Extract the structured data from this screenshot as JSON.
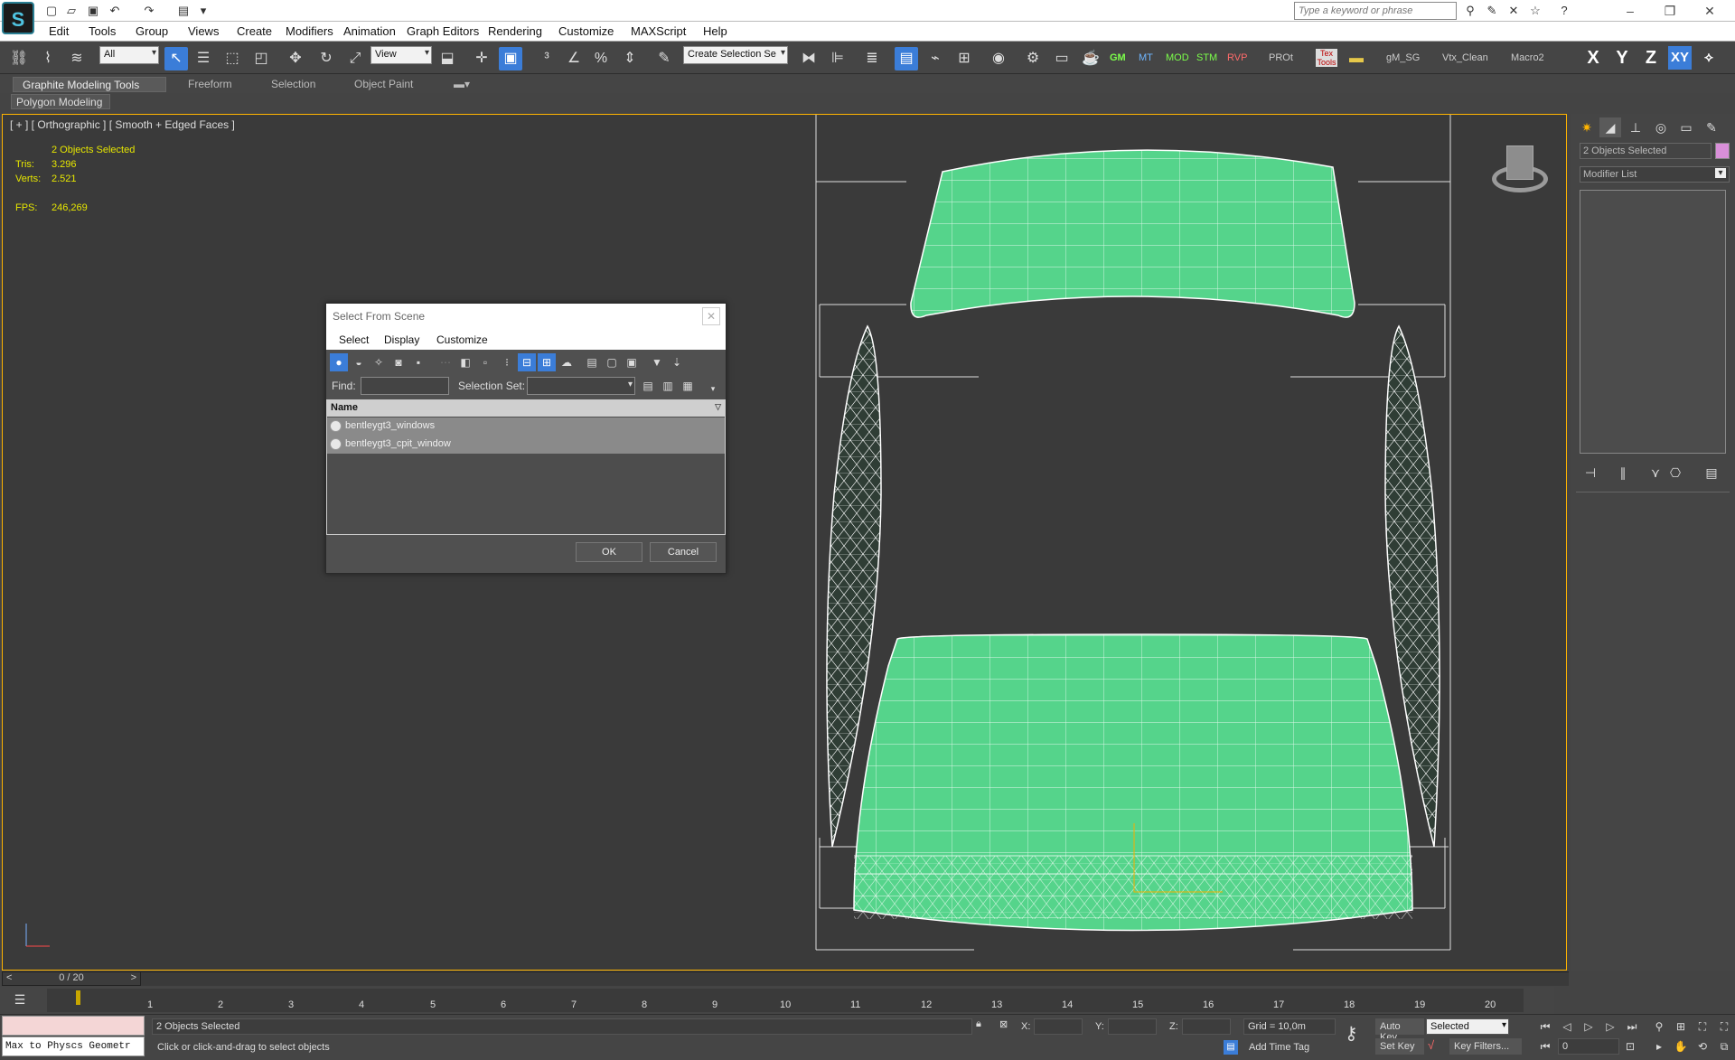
{
  "quick_access": {
    "search_placeholder": "Type a keyword or phrase"
  },
  "menu": [
    "Edit",
    "Tools",
    "Group",
    "Views",
    "Create",
    "Modifiers",
    "Animation",
    "Graph Editors",
    "Rendering",
    "Customize",
    "MAXScript",
    "Help"
  ],
  "toolbar": {
    "selection_filter": "All",
    "ref_coord": "View",
    "named_selection": "Create Selection Se",
    "scripts": [
      "GM",
      "MT",
      "MOD",
      "STM",
      "RVP",
      "PROt",
      "Tex Tools",
      "gM_SG",
      "Vtx_Clean",
      "Macro2"
    ],
    "axes": [
      "X",
      "Y",
      "Z",
      "XY"
    ]
  },
  "ribbon": {
    "tabs": [
      "Graphite Modeling Tools",
      "Freeform",
      "Selection",
      "Object Paint"
    ],
    "sub_panel": "Polygon Modeling"
  },
  "viewport": {
    "label": "[ + ] [ Orthographic ] [ Smooth + Edged Faces ]",
    "selected_caption": "2 Objects Selected",
    "tris_label": "Tris:",
    "tris_value": "3.296",
    "verts_label": "Verts:",
    "verts_value": "2.521",
    "fps_label": "FPS:",
    "fps_value": "246,269",
    "mesh_color": "#55d48b"
  },
  "dialog": {
    "title": "Select From Scene",
    "menu": [
      "Select",
      "Display",
      "Customize"
    ],
    "find_label": "Find:",
    "find_value": "",
    "selection_set_label": "Selection Set:",
    "selection_set_value": "",
    "column_header": "Name",
    "rows": [
      "bentleygt3_windows",
      "bentleygt3_cpit_window"
    ],
    "ok_label": "OK",
    "cancel_label": "Cancel"
  },
  "command_panel": {
    "object_name": "2 Objects Selected",
    "object_color": "#d98fd9",
    "modifier_list": "Modifier List"
  },
  "timeline": {
    "position": "0 / 20",
    "ticks": [
      "1",
      "2",
      "3",
      "4",
      "5",
      "6",
      "7",
      "8",
      "9",
      "10",
      "11",
      "12",
      "13",
      "14",
      "15",
      "16",
      "17",
      "18",
      "19",
      "20"
    ]
  },
  "statusbar": {
    "script_listener": "Max to Physcs Geometr",
    "selection_status": "2 Objects Selected",
    "prompt": "Click or click-and-drag to select objects",
    "x_label": "X:",
    "y_label": "Y:",
    "z_label": "Z:",
    "grid": "Grid = 10,0m",
    "add_time_tag": "Add Time Tag",
    "auto_key": "Auto Key",
    "set_key": "Set Key",
    "key_mode": "Selected",
    "key_filters": "Key Filters...",
    "frame": "0"
  }
}
